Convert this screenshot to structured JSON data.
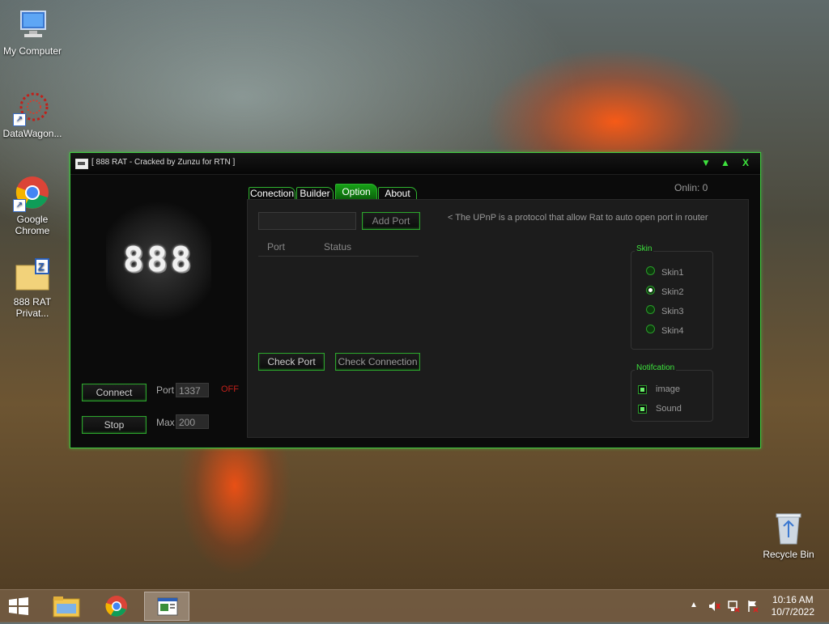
{
  "desktop": {
    "icons": [
      {
        "label": "My Computer"
      },
      {
        "label": "DataWagon..."
      },
      {
        "label": "Google Chrome"
      },
      {
        "label": "888 RAT Privat..."
      },
      {
        "label": "Recycle Bin"
      }
    ]
  },
  "window": {
    "title": "[  888 RAT - Cracked by Zunzu for RTN ]",
    "logo_text": "888",
    "controls": {
      "minimize": "▼",
      "maximize": "▲",
      "close": "X"
    },
    "left": {
      "connect_label": "Connect",
      "stop_label": "Stop",
      "port_label": "Port",
      "port_value": "1337",
      "status_text": "OFF",
      "max_label": "Max",
      "max_value": "200"
    },
    "tabs": [
      {
        "label": "Conection"
      },
      {
        "label": "Builder"
      },
      {
        "label": "Option"
      },
      {
        "label": "About"
      }
    ],
    "online_text": "Onlin:  0",
    "option": {
      "port_input_value": "",
      "add_port_label": "Add Port",
      "upnp_note": "< The UPnP is a protocol that allow Rat to auto open port in router",
      "columns": [
        "Port",
        "Status"
      ],
      "check_port_label": "Check Port",
      "check_connection_label": "Check Connection",
      "skin": {
        "legend": "Skin",
        "options": [
          "Skin1",
          "Skin2",
          "Skin3",
          "Skin4"
        ],
        "selected": "Skin2"
      },
      "notification": {
        "legend": "Notifcation",
        "options": [
          {
            "label": "image",
            "checked": true
          },
          {
            "label": "Sound",
            "checked": true
          }
        ]
      }
    }
  },
  "taskbar": {
    "clock_time": "10:16 AM",
    "clock_date": "10/7/2022"
  },
  "colors": {
    "accent_green": "#3de23d",
    "status_off": "#c0201a"
  }
}
